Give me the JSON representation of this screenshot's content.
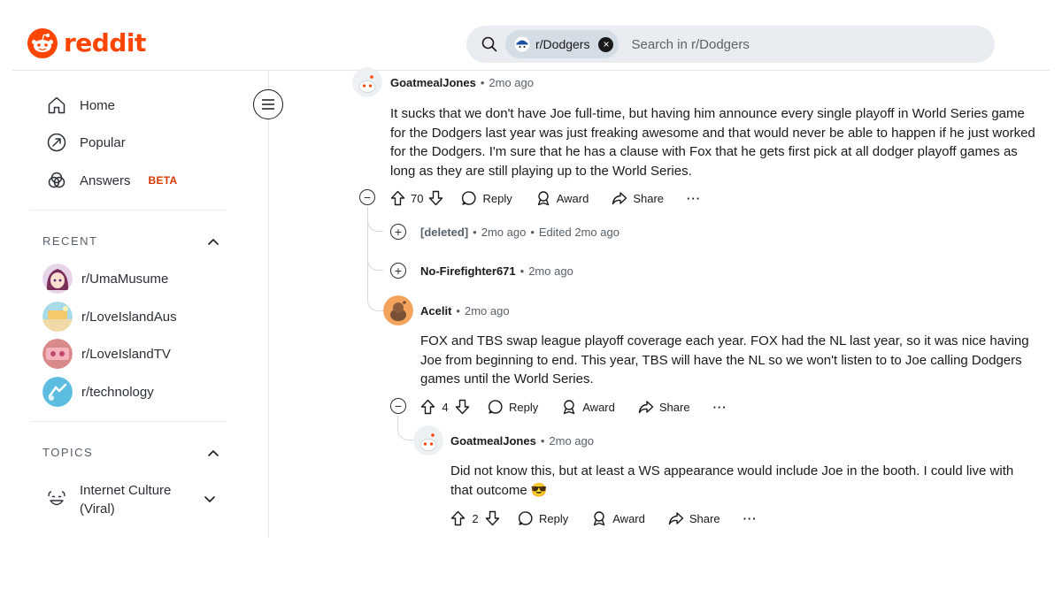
{
  "header": {
    "logo_text": "reddit",
    "search_chip": "r/Dodgers",
    "search_placeholder": "Search in r/Dodgers",
    "brand_color": "#ff4500"
  },
  "sidebar": {
    "nav": [
      {
        "label": "Home",
        "icon": "home-icon"
      },
      {
        "label": "Popular",
        "icon": "popular-icon"
      },
      {
        "label": "Answers",
        "icon": "answers-icon",
        "badge": "BETA"
      }
    ],
    "recent_title": "RECENT",
    "recent": [
      {
        "label": "r/UmaMusume",
        "icon": "subreddit-avatar"
      },
      {
        "label": "r/LoveIslandAus",
        "icon": "subreddit-avatar"
      },
      {
        "label": "r/LoveIslandTV",
        "icon": "subreddit-avatar"
      },
      {
        "label": "r/technology",
        "icon": "subreddit-avatar"
      }
    ],
    "topics_title": "TOPICS",
    "topics": [
      {
        "label": "Internet Culture (Viral)",
        "icon": "smiley-icon"
      }
    ]
  },
  "comments": [
    {
      "author": "GoatmealJones",
      "age": "2mo ago",
      "body": "It sucks that we don't have Joe full-time, but having him announce every single playoff in World Series game for the Dodgers last year was just freaking awesome and that would never be able to happen if he just worked for the Dodgers. I'm sure that he has a clause with Fox that he gets first pick at all dodger playoff games as long as they are still playing up to the World Series.",
      "votes": "70"
    },
    {
      "author": "[deleted]",
      "age": "2mo ago",
      "edited": "Edited 2mo ago"
    },
    {
      "author": "No-Firefighter671",
      "age": "2mo ago"
    },
    {
      "author": "Acelit",
      "age": "2mo ago",
      "body": "FOX and TBS swap league playoff coverage each year. FOX had the NL last year, so it was nice having Joe from beginning to end. This year, TBS will have the NL so we won't listen to to Joe calling Dodgers games until the World Series.",
      "votes": "4"
    },
    {
      "author": "GoatmealJones",
      "age": "2mo ago",
      "body": "Did not know this, but at least a WS appearance would include Joe in the booth. I could live with that outcome 😎",
      "votes": "2"
    }
  ],
  "actions": {
    "reply": "Reply",
    "award": "Award",
    "share": "Share",
    "more": "···"
  },
  "separator": "•"
}
